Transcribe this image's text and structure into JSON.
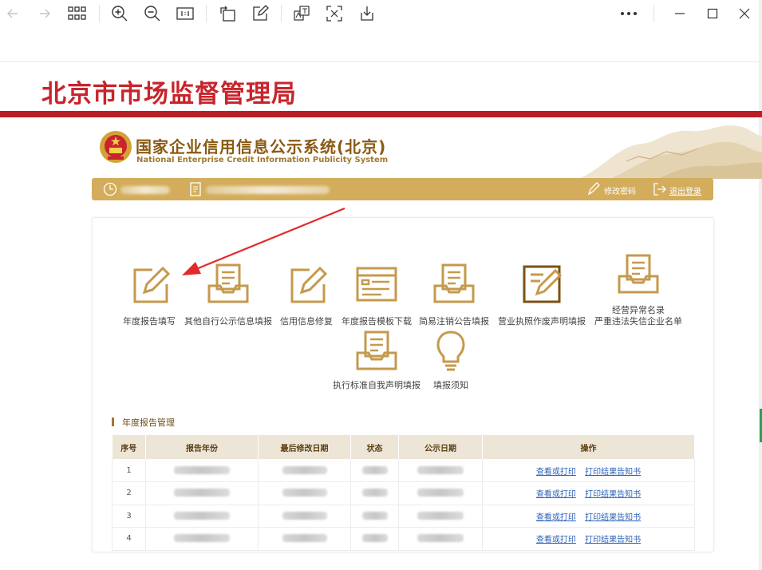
{
  "bureau_title": "北京市市场监督管理局",
  "system": {
    "title_cn": "国家企业信用信息公示系统(北京)",
    "title_en": "National Enterprise Credit Information Publicity System"
  },
  "userbar": {
    "change_password": "修改密码",
    "logout": "退出登录"
  },
  "tiles": [
    {
      "label": "年度报告填写",
      "icon": "edit-pencil-icon"
    },
    {
      "label": "其他自行公示信息填报",
      "icon": "inbox-tray-icon"
    },
    {
      "label": "信用信息修复",
      "icon": "edit-pencil-icon"
    },
    {
      "label": "年度报告模板下载",
      "icon": "template-form-icon"
    },
    {
      "label": "简易注销公告填报",
      "icon": "inbox-tray-icon"
    },
    {
      "label": "营业执照作废声明填报",
      "icon": "edit-pencil-icon"
    },
    {
      "label": "经营异常名录",
      "label2": "严重违法失信企业名单",
      "icon": "inbox-tray-icon"
    },
    {
      "label": "执行标准自我声明填报",
      "icon": "inbox-tray-icon"
    },
    {
      "label": "填报须知",
      "icon": "lightbulb-icon"
    }
  ],
  "section_title": "年度报告管理",
  "table": {
    "headers": [
      "序号",
      "报告年份",
      "最后修改日期",
      "状态",
      "公示日期",
      "操作"
    ],
    "rows": [
      {
        "no": "1",
        "view": "查看或打印",
        "print": "打印结果告知书"
      },
      {
        "no": "2",
        "view": "查看或打印",
        "print": "打印结果告知书"
      },
      {
        "no": "3",
        "view": "查看或打印",
        "print": "打印结果告知书"
      },
      {
        "no": "4",
        "view": "查看或打印",
        "print": "打印结果告知书"
      }
    ]
  },
  "colors": {
    "brand_red": "#c8242c",
    "gold": "#d3ad5c",
    "icon_gold": "#c49a4c",
    "link_blue": "#2f63b8",
    "arrow_red": "#e32a2a"
  }
}
